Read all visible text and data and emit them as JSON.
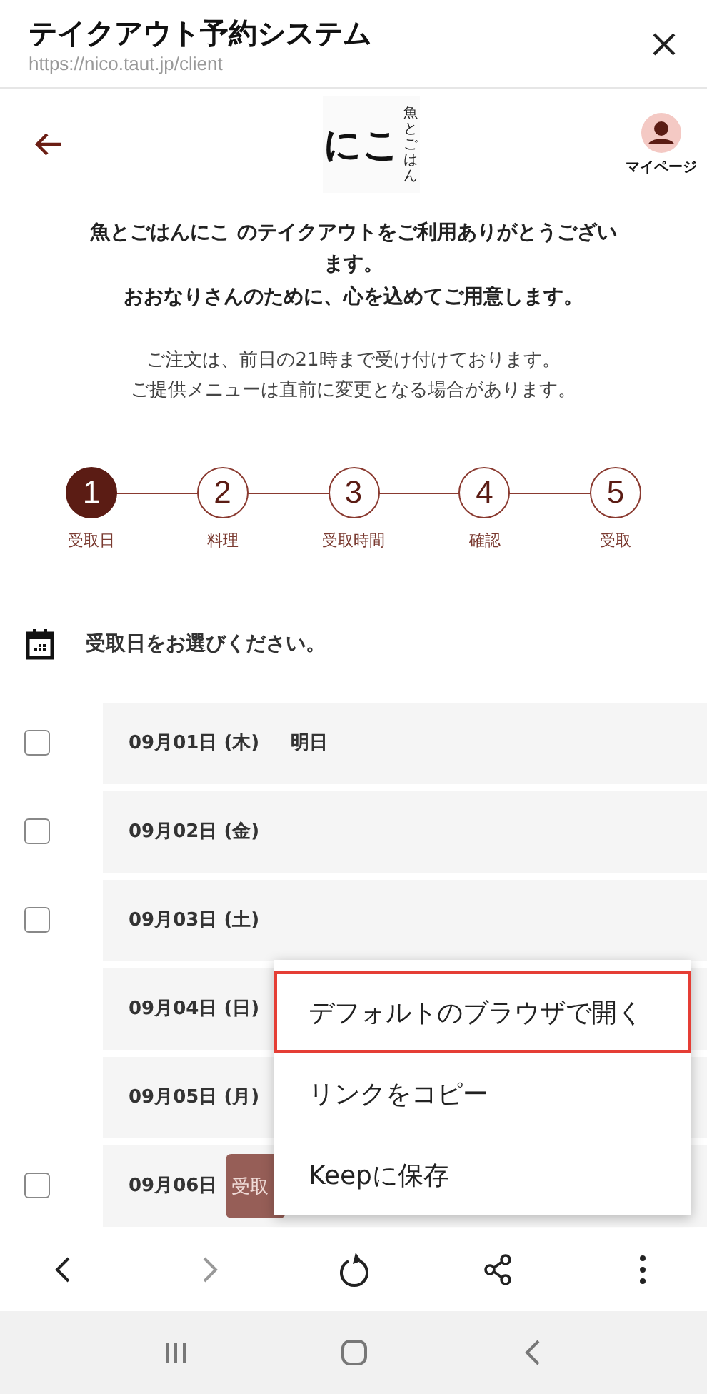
{
  "browser": {
    "title": "テイクアウト予約システム",
    "url": "https://nico.taut.jp/client"
  },
  "app_bar": {
    "logo": {
      "name": "にこ",
      "tagline": "魚とごはん"
    },
    "account_label": "マイページ"
  },
  "greeting": [
    "魚とごはんにこ のテイクアウトをご利用ありがとうございます。",
    "おおなりさんのために、心を込めてご用意します。"
  ],
  "notice": [
    "ご注文は、前日の21時まで受け付けております。",
    "ご提供メニューは直前に変更となる場合があります。"
  ],
  "steps": [
    {
      "number": "1",
      "label": "受取日",
      "selected": true
    },
    {
      "number": "2",
      "label": "料理",
      "selected": false
    },
    {
      "number": "3",
      "label": "受取時間",
      "selected": false
    },
    {
      "number": "4",
      "label": "確認",
      "selected": false
    },
    {
      "number": "5",
      "label": "受取",
      "selected": false
    }
  ],
  "section_heading": "受取日をお選びください。",
  "dates": [
    {
      "kind": "checkbox",
      "label": "09月01日 (木)",
      "note": "明日",
      "checked": false
    },
    {
      "kind": "checkbox",
      "label": "09月02日 (金)",
      "checked": false
    },
    {
      "kind": "checkbox",
      "label": "09月03日 (土)",
      "checked": false
    },
    {
      "kind": "plain",
      "label": "09月04日 (日)"
    },
    {
      "kind": "plain",
      "label": "09月05日 (月)"
    },
    {
      "kind": "checkbox",
      "label": "09月06日",
      "checked": false
    }
  ],
  "floating_button": "受取",
  "menu": [
    {
      "label": "デフォルトのブラウザで開く",
      "highlighted": true
    },
    {
      "label": "リンクをコピー",
      "highlighted": false
    },
    {
      "label": "Keepに保存",
      "highlighted": false
    }
  ],
  "toolbar": [
    {
      "kind": "back",
      "disabled": false
    },
    {
      "kind": "forward",
      "disabled": true
    },
    {
      "kind": "reload",
      "disabled": false
    },
    {
      "kind": "share",
      "disabled": false
    },
    {
      "kind": "more",
      "disabled": false
    }
  ],
  "system_nav": [
    {
      "kind": "recents"
    },
    {
      "kind": "home"
    },
    {
      "kind": "back"
    }
  ]
}
